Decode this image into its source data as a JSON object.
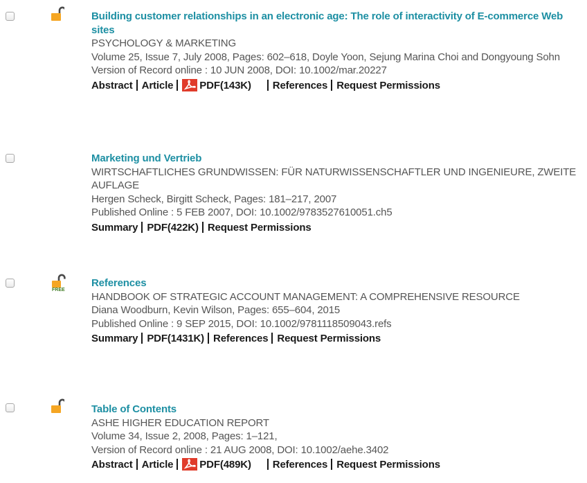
{
  "results": [
    {
      "title": "Building customer relationships in an electronic age: The role of interactivity of E-commerce Web sites",
      "source": "PSYCHOLOGY & MARKETING",
      "details": "Volume 25, Issue 7, July 2008, Pages: 602–618, Doyle Yoon, Sejung Marina Choi and Dongyoung Sohn",
      "published": "Version of Record online : 10 JUN 2008, DOI: 10.1002/mar.20227",
      "access_icon": "open-lock-icon",
      "links": {
        "abstract": "Abstract",
        "article": "Article",
        "pdf": "PDF(143K)",
        "references": "References",
        "permissions": "Request Permissions"
      }
    },
    {
      "title": "Marketing und Vertrieb",
      "source": "WIRTSCHAFTLICHES GRUNDWISSEN: FÜR NATURWISSENSCHAFTLER UND INGENIEURE, ZWEITE AUFLAGE",
      "details": "Hergen Scheck, Birgitt Scheck, Pages: 181–217, 2007",
      "published": "Published Online : 5 FEB 2007, DOI: 10.1002/9783527610051.ch5",
      "links": {
        "summary": "Summary",
        "pdf": "PDF(422K)",
        "permissions": "Request Permissions"
      }
    },
    {
      "title": "References",
      "source": "HANDBOOK OF STRATEGIC ACCOUNT MANAGEMENT: A COMPREHENSIVE RESOURCE",
      "details": "Diana Woodburn, Kevin Wilson, Pages: 655–604, 2015",
      "published": "Published Online : 9 SEP 2015, DOI: 10.1002/9781118509043.refs",
      "access_icon": "free-lock-icon",
      "access_label": "FREE",
      "links": {
        "summary": "Summary",
        "pdf": "PDF(1431K)",
        "references": "References",
        "permissions": "Request Permissions"
      }
    },
    {
      "title": "Table of Contents",
      "source": "ASHE HIGHER EDUCATION REPORT",
      "details": "Volume 34, Issue 2, 2008, Pages: 1–121,",
      "published": "Version of Record online : 21 AUG 2008, DOI: 10.1002/aehe.3402",
      "access_icon": "open-lock-icon",
      "links": {
        "abstract": "Abstract",
        "article": "Article",
        "pdf": "PDF(489K)",
        "references": "References",
        "permissions": "Request Permissions"
      }
    }
  ],
  "colors": {
    "title": "#1d8fa3",
    "lock": "#f5a623",
    "pdf": "#e03b2b"
  }
}
